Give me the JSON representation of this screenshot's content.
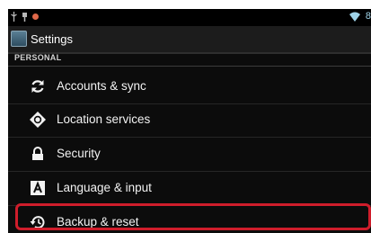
{
  "app_title": "Settings",
  "status_bar": {
    "left_icons": [
      "usb-debug-icon",
      "usb-icon",
      "notification-dot-icon"
    ],
    "right_icons": [
      "wifi-icon"
    ],
    "clock_partial": "8"
  },
  "section": {
    "label": "PERSONAL"
  },
  "items": [
    {
      "label": "Accounts & sync",
      "icon": "sync-icon"
    },
    {
      "label": "Location services",
      "icon": "location-target-icon"
    },
    {
      "label": "Security",
      "icon": "lock-icon"
    },
    {
      "label": "Language & input",
      "icon": "keyboard-a-icon"
    },
    {
      "label": "Backup & reset",
      "icon": "backup-restore-icon",
      "highlighted": true
    }
  ],
  "colors": {
    "background": "#0c0c0c",
    "text": "#f2f2f2",
    "highlight_border": "#cf1d2b",
    "status_accent": "#9fd3e8"
  }
}
